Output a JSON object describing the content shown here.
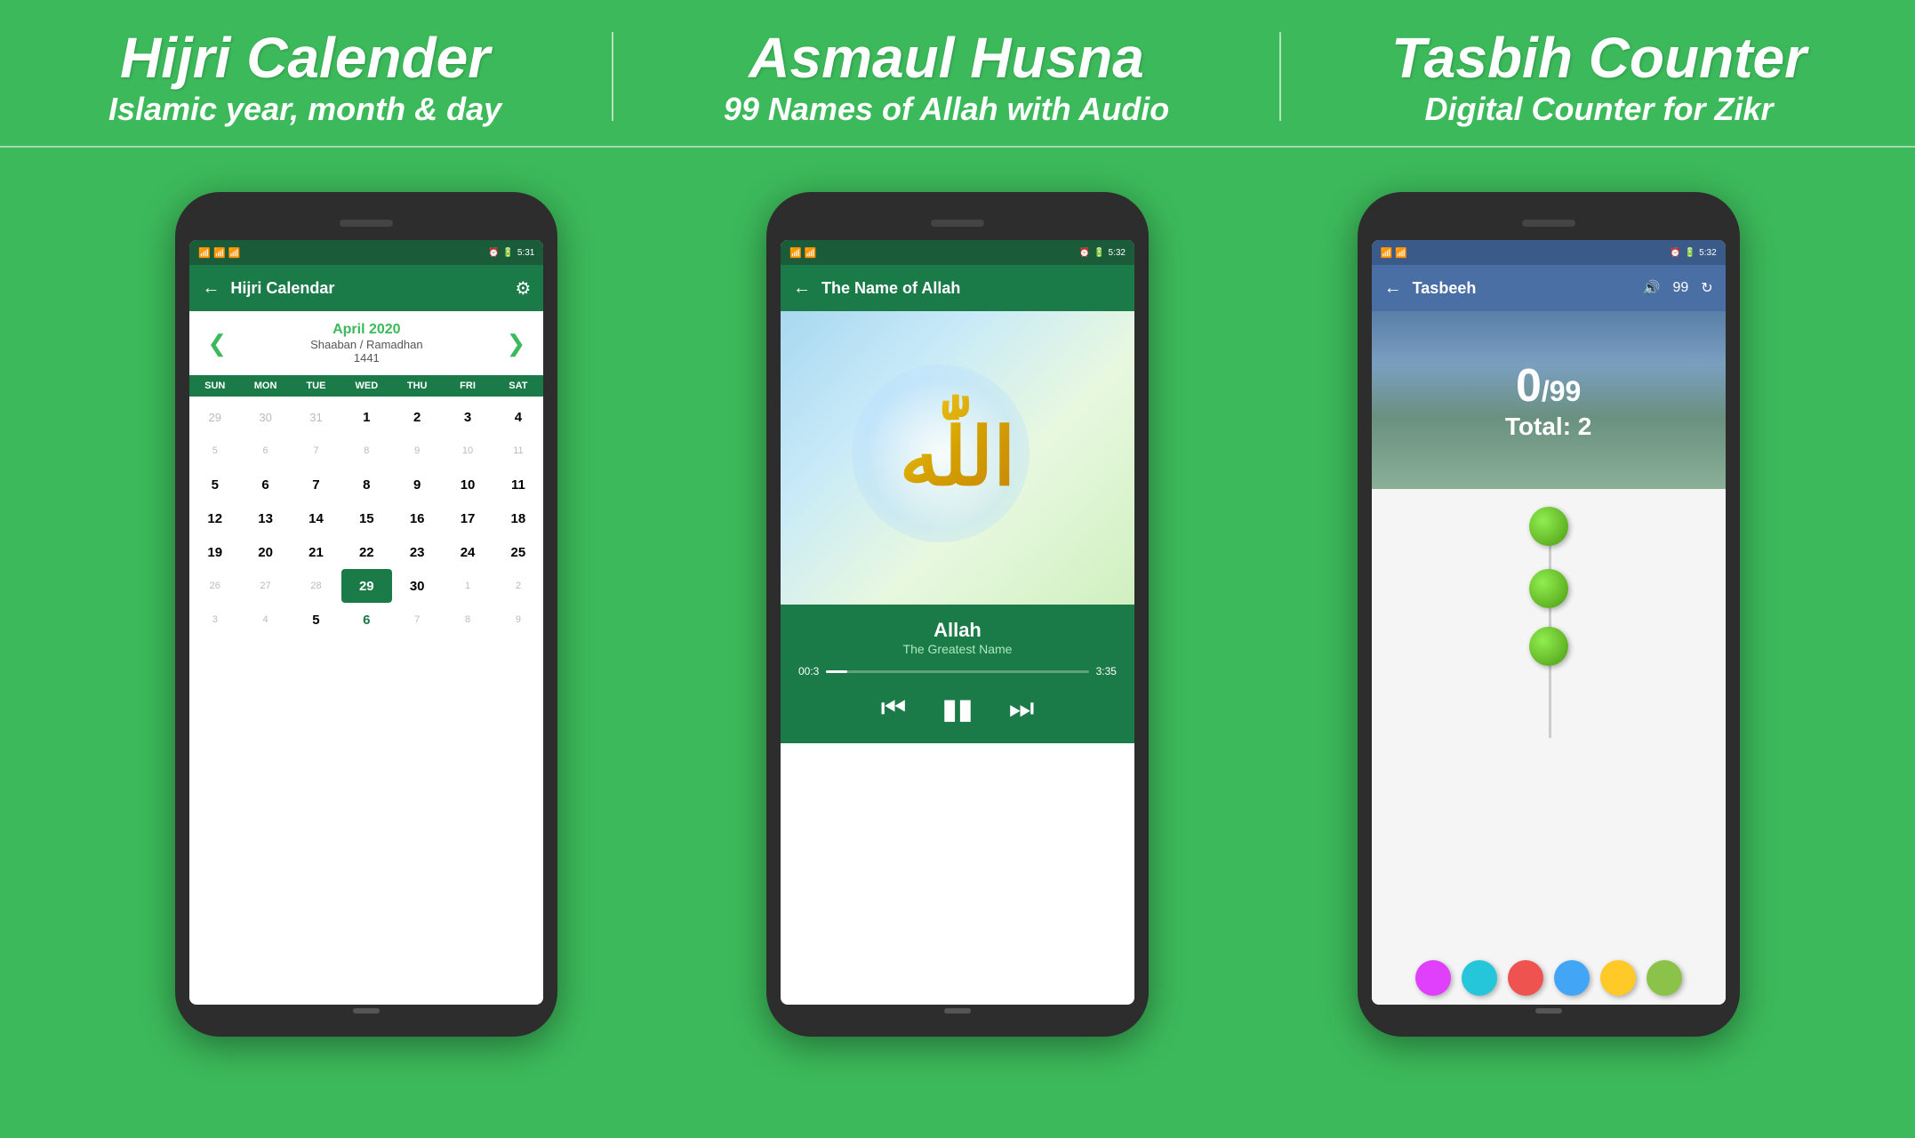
{
  "header": {
    "section1": {
      "title": "Hijri Calender",
      "subtitle": "Islamic year, month & day"
    },
    "section2": {
      "title": "Asmaul Husna",
      "subtitle": "99 Names of Allah with Audio"
    },
    "section3": {
      "title": "Tasbih Counter",
      "subtitle": "Digital Counter for Zikr"
    }
  },
  "phone1": {
    "status": {
      "signal": "📶📶",
      "wifi": "📶",
      "time": "5:31",
      "battery": "⬛5"
    },
    "appbar": {
      "back": "←",
      "title": "Hijri Calendar",
      "settings_icon": "⚙"
    },
    "calendar": {
      "month_year": "April 2020",
      "hijri": "Shaaban / Ramadhan",
      "year_hijri": "1441",
      "prev": "❮",
      "next": "❯",
      "weekdays": [
        "SUN",
        "MON",
        "TUE",
        "WED",
        "THU",
        "FRI",
        "SAT"
      ],
      "rows": [
        [
          {
            "n": "29",
            "dim": true
          },
          {
            "n": "30",
            "dim": true
          },
          {
            "n": "31",
            "dim": true
          },
          {
            "n": "1",
            "bold": true
          },
          {
            "n": "2",
            "bold": true
          },
          {
            "n": "3",
            "bold": true
          },
          {
            "n": "4",
            "bold": true
          }
        ],
        [
          {
            "n": "5",
            "dim": true
          },
          {
            "n": "6",
            "dim": true
          },
          {
            "n": "7",
            "dim": true
          },
          {
            "n": "8",
            "bold": true
          },
          {
            "n": "9",
            "bold": true
          },
          {
            "n": "10",
            "bold": true
          },
          {
            "n": "11",
            "bold": true
          }
        ],
        [
          {
            "n": "5",
            "bold": true
          },
          {
            "n": "6",
            "bold": true
          },
          {
            "n": "7",
            "bold": true
          },
          {
            "n": "8",
            "bold": true
          },
          {
            "n": "9",
            "bold": true
          },
          {
            "n": "10",
            "bold": true
          },
          {
            "n": "11",
            "bold": true
          }
        ],
        [
          {
            "n": "12",
            "bold": true
          },
          {
            "n": "13",
            "bold": true
          },
          {
            "n": "14",
            "bold": true
          },
          {
            "n": "15",
            "bold": true
          },
          {
            "n": "16",
            "bold": true
          },
          {
            "n": "17",
            "bold": true
          },
          {
            "n": "18",
            "bold": true
          }
        ],
        [
          {
            "n": "19",
            "bold": true
          },
          {
            "n": "20",
            "bold": true
          },
          {
            "n": "21",
            "bold": true
          },
          {
            "n": "22",
            "bold": true
          },
          {
            "n": "23",
            "bold": true
          },
          {
            "n": "24",
            "bold": true
          },
          {
            "n": "25",
            "bold": true
          }
        ],
        [
          {
            "n": "26",
            "dim": true
          },
          {
            "n": "27",
            "dim": true
          },
          {
            "n": "28",
            "dim": true
          },
          {
            "n": "29",
            "bold": true,
            "selected": true
          },
          {
            "n": "30",
            "bold": true
          },
          {
            "n": "1",
            "dim": true
          },
          {
            "n": "2",
            "dim": true
          }
        ],
        [
          {
            "n": "3",
            "dim": true
          },
          {
            "n": "4",
            "dim": true
          },
          {
            "n": "5",
            "bold": true
          },
          {
            "n": "6",
            "bold": true,
            "green": true
          },
          {
            "n": "7",
            "dim": true
          },
          {
            "n": "8",
            "dim": true
          },
          {
            "n": "9",
            "dim": true
          }
        ]
      ]
    }
  },
  "phone2": {
    "status": {
      "time": "5:32"
    },
    "appbar": {
      "back": "←",
      "title": "The Name of Allah"
    },
    "player": {
      "song_title": "Allah",
      "song_subtitle": "The Greatest Name",
      "time_current": "00:3",
      "time_total": "3:35",
      "prev_icon": "⏮",
      "play_icon": "⏸",
      "next_icon": "⏭"
    }
  },
  "phone3": {
    "status": {
      "time": "5:32"
    },
    "appbar": {
      "back": "←",
      "title": "Tasbeeh",
      "volume_icon": "🔊",
      "count": "99",
      "refresh_icon": "↻"
    },
    "counter": {
      "current": "0",
      "max": "/99",
      "total_label": "Total: 2"
    },
    "colors": [
      "#e040fb",
      "#26c6da",
      "#ef5350",
      "#42a5f5",
      "#ffca28",
      "#8bc34a"
    ]
  },
  "bg_color": "#3cb95a",
  "accent_color": "#1a7a48"
}
